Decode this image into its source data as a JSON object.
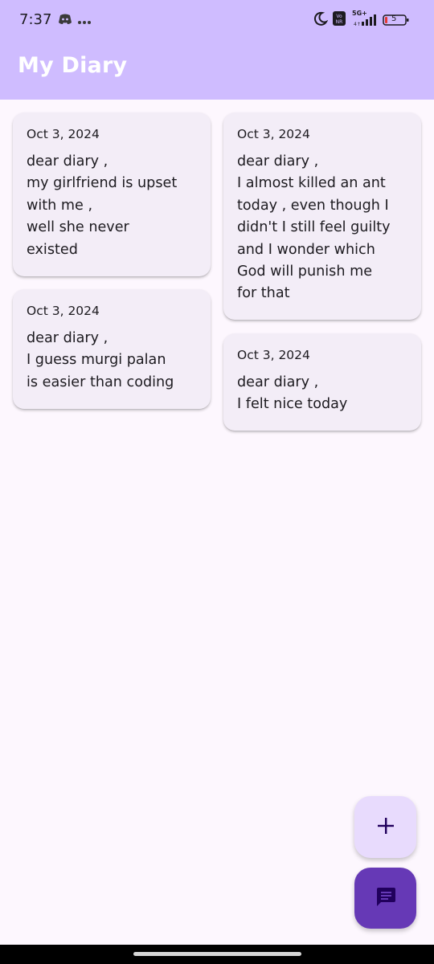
{
  "status_bar": {
    "time": "7:37",
    "network": "5G+",
    "volte": "Vo\nNR",
    "battery": "5"
  },
  "app_bar": {
    "title": "My Diary"
  },
  "entries": [
    {
      "date": "Oct 3, 2024",
      "text": "dear diary ,\nmy girlfriend is upset\nwith me ,\nwell she never\nexisted"
    },
    {
      "date": "Oct 3, 2024",
      "text": "dear diary ,\nI almost killed an ant\ntoday , even though I\ndidn't I still feel guilty\nand I wonder which\nGod will punish me\nfor that"
    },
    {
      "date": "Oct 3, 2024",
      "text": "dear diary ,\nI guess murgi palan\nis easier than coding"
    },
    {
      "date": "Oct 3, 2024",
      "text": "dear diary ,\nI felt nice today"
    }
  ],
  "colors": {
    "app_bar": "#cfbcff",
    "background": "#fdf7fe",
    "card": "#f3edf7",
    "fab_add": "#e8dbfd",
    "fab_notes": "#6639b6"
  },
  "icons": {
    "add_fab": "plus-icon",
    "notes_fab": "chat-notes-icon",
    "dnd": "moon-icon",
    "discord": "game-controller-icon"
  }
}
